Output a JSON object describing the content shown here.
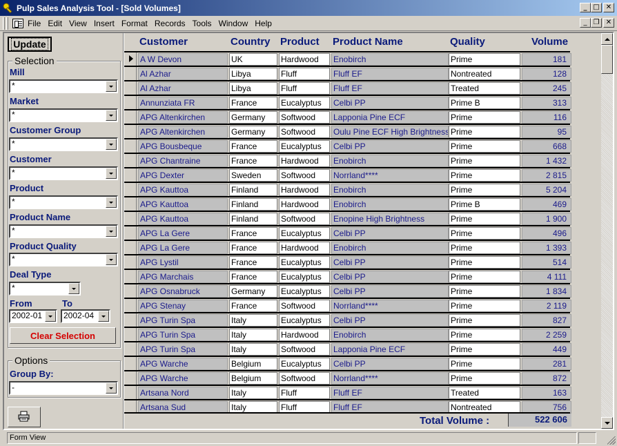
{
  "window": {
    "title": "Pulp Sales Analysis Tool - [Sold Volumes]",
    "icon": "key-icon"
  },
  "menu": {
    "items": [
      {
        "label": "File",
        "accel": "F"
      },
      {
        "label": "Edit",
        "accel": "E"
      },
      {
        "label": "View",
        "accel": "V"
      },
      {
        "label": "Insert",
        "accel": "I"
      },
      {
        "label": "Format",
        "accel": "o"
      },
      {
        "label": "Records",
        "accel": "R"
      },
      {
        "label": "Tools",
        "accel": "T"
      },
      {
        "label": "Window",
        "accel": "W"
      },
      {
        "label": "Help",
        "accel": "H"
      }
    ]
  },
  "left": {
    "update_label": "Update",
    "selection_legend": "Selection",
    "filters": [
      {
        "label": "Mill",
        "value": "*"
      },
      {
        "label": "Market",
        "value": "*"
      },
      {
        "label": "Customer Group",
        "value": "*"
      },
      {
        "label": "Customer",
        "value": "*"
      },
      {
        "label": "Product",
        "value": "*"
      },
      {
        "label": "Product Name",
        "value": "*"
      },
      {
        "label": "Product Quality",
        "value": "*"
      },
      {
        "label": "Deal Type",
        "value": "*"
      }
    ],
    "from_label": "From",
    "from_value": "2002-01",
    "to_label": "To",
    "to_value": "2002-04",
    "clear_label": "Clear Selection",
    "options_legend": "Options",
    "group_by_label": "Group By:",
    "group_by_value": "-",
    "print_icon": "printer-icon"
  },
  "table": {
    "columns": [
      "Customer",
      "Country",
      "Product",
      "Product Name",
      "Quality",
      "Volume"
    ],
    "rows": [
      [
        "A W Devon",
        "UK",
        "Hardwood",
        "Enobirch",
        "Prime",
        "181"
      ],
      [
        "Al Azhar",
        "Libya",
        "Fluff",
        "Fluff EF",
        "Nontreated",
        "128"
      ],
      [
        "Al Azhar",
        "Libya",
        "Fluff",
        "Fluff EF",
        "Treated",
        "245"
      ],
      [
        "Annunziata FR",
        "France",
        "Eucalyptus",
        "Celbi PP",
        "Prime B",
        "313"
      ],
      [
        "APG Altenkirchen",
        "Germany",
        "Softwood",
        "Lapponia Pine ECF",
        "Prime",
        "116"
      ],
      [
        "APG Altenkirchen",
        "Germany",
        "Softwood",
        "Oulu Pine ECF High Brightness",
        "Prime",
        "95"
      ],
      [
        "APG Bousbeque",
        "France",
        "Eucalyptus",
        "Celbi PP",
        "Prime",
        "668"
      ],
      [
        "APG Chantraine",
        "France",
        "Hardwood",
        "Enobirch",
        "Prime",
        "1 432"
      ],
      [
        "APG Dexter",
        "Sweden",
        "Softwood",
        "Norrland****",
        "Prime",
        "2 815"
      ],
      [
        "APG Kauttoa",
        "Finland",
        "Hardwood",
        "Enobirch",
        "Prime",
        "5 204"
      ],
      [
        "APG Kauttoa",
        "Finland",
        "Hardwood",
        "Enobirch",
        "Prime B",
        "469"
      ],
      [
        "APG Kauttoa",
        "Finland",
        "Softwood",
        "Enopine High Brightness",
        "Prime",
        "1 900"
      ],
      [
        "APG La Gere",
        "France",
        "Eucalyptus",
        "Celbi PP",
        "Prime",
        "496"
      ],
      [
        "APG La Gere",
        "France",
        "Hardwood",
        "Enobirch",
        "Prime",
        "1 393"
      ],
      [
        "APG Lystil",
        "France",
        "Eucalyptus",
        "Celbi PP",
        "Prime",
        "514"
      ],
      [
        "APG Marchais",
        "France",
        "Eucalyptus",
        "Celbi PP",
        "Prime",
        "4 111"
      ],
      [
        "APG Osnabruck",
        "Germany",
        "Eucalyptus",
        "Celbi PP",
        "Prime",
        "1 834"
      ],
      [
        "APG Stenay",
        "France",
        "Softwood",
        "Norrland****",
        "Prime",
        "2 119"
      ],
      [
        "APG Turin Spa",
        "Italy",
        "Eucalyptus",
        "Celbi PP",
        "Prime",
        "827"
      ],
      [
        "APG Turin Spa",
        "Italy",
        "Hardwood",
        "Enobirch",
        "Prime",
        "2 259"
      ],
      [
        "APG Turin Spa",
        "Italy",
        "Softwood",
        "Lapponia Pine ECF",
        "Prime",
        "449"
      ],
      [
        "APG Warche",
        "Belgium",
        "Eucalyptus",
        "Celbi PP",
        "Prime",
        "281"
      ],
      [
        "APG Warche",
        "Belgium",
        "Softwood",
        "Norrland****",
        "Prime",
        "872"
      ],
      [
        "Artsana Nord",
        "Italy",
        "Fluff",
        "Fluff EF",
        "Treated",
        "163"
      ],
      [
        "Artsana Sud",
        "Italy",
        "Fluff",
        "Fluff EF",
        "Nontreated",
        "756"
      ]
    ],
    "total_label": "Total Volume :",
    "total_value": "522 606"
  },
  "status": {
    "text": "Form View"
  },
  "colors": {
    "label_blue": "#0a1a7a",
    "clear_red": "#d40000",
    "title_start": "#0a246a",
    "title_end": "#a6caf0"
  }
}
